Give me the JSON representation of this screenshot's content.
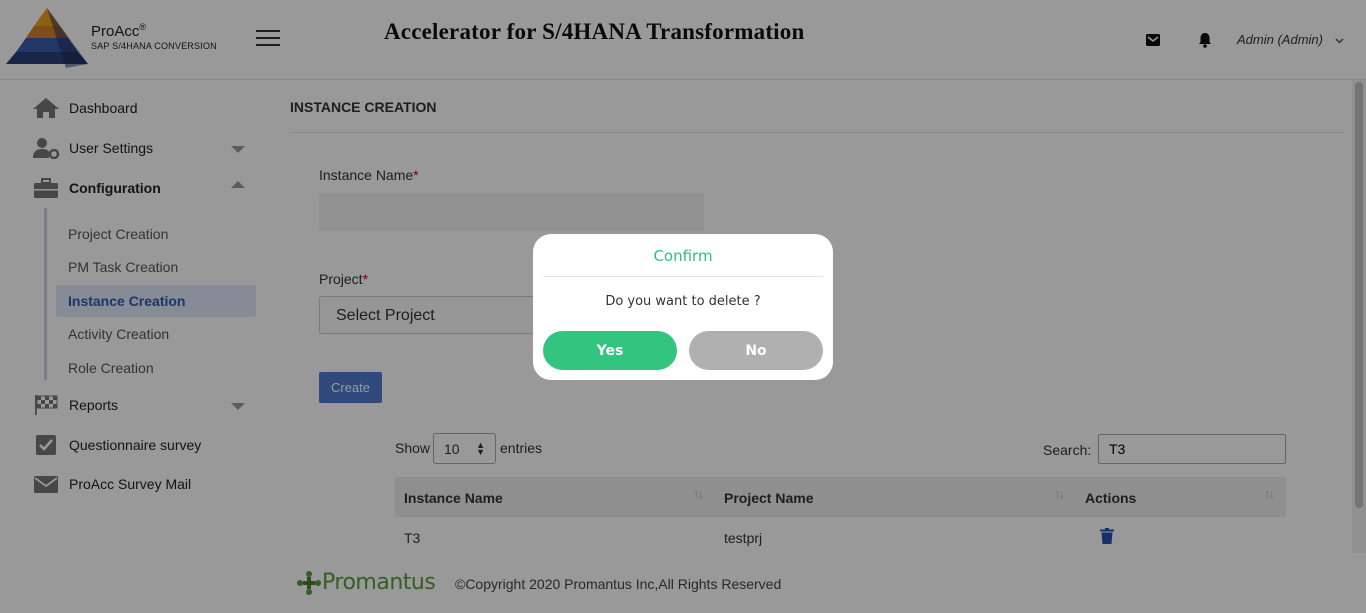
{
  "header": {
    "brand_name": "ProAcc",
    "brand_mark": "®",
    "brand_sub": "SAP S/4HANA CONVERSION",
    "title": "Accelerator for S/4HANA Transformation",
    "user": "Admin (Admin)",
    "icons": [
      "pyramid-logo",
      "hamburger-menu-icon",
      "mail-icon",
      "bell-icon",
      "chevron-down-icon"
    ]
  },
  "sidebar": {
    "items": [
      {
        "label": "Dashboard",
        "icon": "home-icon"
      },
      {
        "label": "User Settings",
        "icon": "user-settings-icon"
      },
      {
        "label": "Configuration",
        "icon": "briefcase-icon"
      },
      {
        "label": "Reports",
        "icon": "checkered-flag-icon"
      },
      {
        "label": "Questionnaire survey",
        "icon": "checkbox-icon"
      },
      {
        "label": "ProAcc Survey Mail",
        "icon": "envelope-icon"
      }
    ],
    "sub_items": [
      {
        "label": "Project Creation"
      },
      {
        "label": "PM Task Creation"
      },
      {
        "label": "Instance Creation"
      },
      {
        "label": "Activity Creation"
      },
      {
        "label": "Role Creation"
      }
    ]
  },
  "main": {
    "heading": "INSTANCE CREATION",
    "instance_label": "Instance Name",
    "required_mark": "*",
    "instance_value": "",
    "project_label": "Project",
    "project_selected": "Select Project",
    "create_label": "Create",
    "show_label": "Show",
    "page_length": "10",
    "entries_label": "entries",
    "search_label": "Search:",
    "search_value": "T3",
    "columns": [
      "Instance Name",
      "Project Name",
      "Actions"
    ],
    "rows": [
      {
        "instance": "T3",
        "project": "testprj"
      }
    ]
  },
  "footer": {
    "logo_text": "Promantus",
    "copyright": "©Copyright 2020 Promantus Inc,All Rights Reserved"
  },
  "dialog": {
    "title": "Confirm",
    "message": "Do you want to delete ?",
    "yes_label": "Yes",
    "no_label": "No"
  },
  "colors": {
    "accent_green": "#33c47f",
    "primary_blue": "#4f7ad0",
    "active_nav": "#2f5aa8",
    "no_button": "#b0b0b0",
    "trash": "#2b4fb3"
  }
}
